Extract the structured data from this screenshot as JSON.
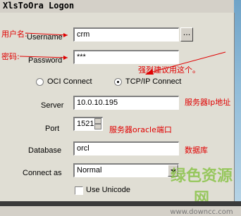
{
  "window": {
    "title": "XlsToOra Logon"
  },
  "fields": {
    "username": {
      "label": "Username",
      "value": "crm",
      "browse": "..."
    },
    "password": {
      "label": "Password",
      "value": "***"
    },
    "server": {
      "label": "Server",
      "value": "10.0.10.195"
    },
    "port": {
      "label": "Port",
      "value": "1521"
    },
    "database": {
      "label": "Database",
      "value": "orcl"
    },
    "connect_as": {
      "label": "Connect as",
      "value": "Normal"
    }
  },
  "connection": {
    "oci_label": "OCI Connect",
    "tcp_label": "TCP/IP Connect",
    "selected": "TCP/IP Connect"
  },
  "options": {
    "use_unicode_label": "Use Unicode",
    "use_unicode_checked": false
  },
  "annotations": {
    "username_note": "用户名:",
    "password_note": "密码:",
    "tcp_note": "强烈建议用这个。",
    "server_note": "服务器Ip地址",
    "port_note": "服务器oracle端口",
    "database_note": "数据库"
  },
  "watermark": {
    "text": "绿色资源网",
    "url": "www.downcc.com"
  },
  "colors": {
    "annotation": "#e00000",
    "window_bg": "#e0ded4",
    "watermark": "#8bc34a"
  }
}
